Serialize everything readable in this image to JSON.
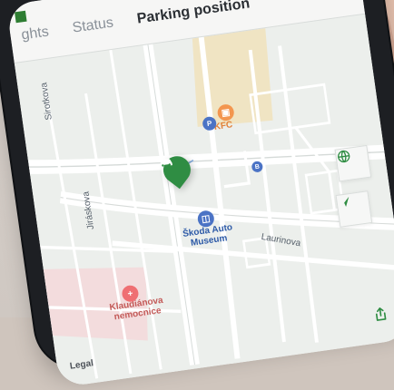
{
  "tabs": [
    {
      "label": "ghts"
    },
    {
      "label": "Status"
    },
    {
      "label": "Parking position"
    }
  ],
  "map": {
    "street_labels": [
      "Sirotkova",
      "Jiráskova",
      "Laurinova"
    ],
    "poi_labels": {
      "kfc": "KFC",
      "museum": "Škoda Auto\nMuseum",
      "hospital": "Klaudiánova\nnemocnice"
    },
    "legal_text": "Legal"
  },
  "icons": {
    "car": "car-icon",
    "globe": "globe-icon",
    "navigation": "navigation-arrow-icon",
    "share": "share-icon"
  },
  "colors": {
    "accent_green": "#2f8d43",
    "kfc_orange": "#f3964f",
    "hospital_red": "#ef6f73",
    "museum_blue": "#4b73c5"
  }
}
